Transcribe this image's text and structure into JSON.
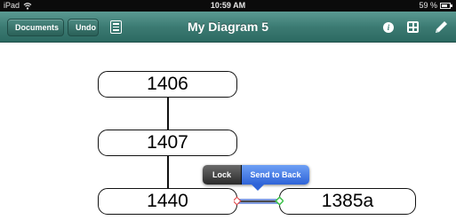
{
  "status_bar": {
    "carrier": "iPad",
    "time": "10:59 AM",
    "battery": "59 %",
    "battery_level": 0.59
  },
  "nav_bar": {
    "documents_label": "Documents",
    "undo_label": "Undo",
    "title": "My Diagram 5",
    "info_glyph": "i",
    "icons": [
      "list-icon",
      "info-icon",
      "grid-icon",
      "pencil-icon"
    ]
  },
  "diagram": {
    "nodes": [
      {
        "id": "1406",
        "label": "1406"
      },
      {
        "id": "1407",
        "label": "1407"
      },
      {
        "id": "1440",
        "label": "1440"
      },
      {
        "id": "1385a",
        "label": "1385a"
      }
    ],
    "connections": [
      {
        "from": "1406",
        "to": "1407"
      },
      {
        "from": "1407",
        "to": "1440"
      },
      {
        "from": "1440",
        "to": "1385a",
        "selected": true
      }
    ]
  },
  "context_menu": {
    "lock_label": "Lock",
    "send_to_back_label": "Send to Back"
  },
  "colors": {
    "nav_accent": "#3c7b73",
    "selection_blue": "#2e63d8",
    "handle_red": "#e04040",
    "handle_green": "#3cc24a"
  }
}
